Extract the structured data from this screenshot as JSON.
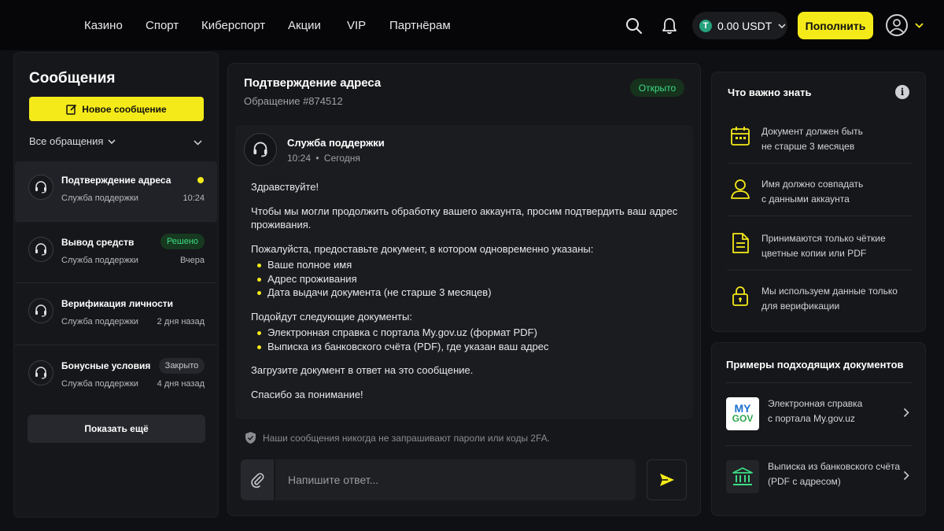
{
  "topbar": {
    "nav": [
      "Казино",
      "Спорт",
      "Киберспорт",
      "Акции",
      "VIP",
      "Партнёрам"
    ],
    "icons": {
      "search": "search-icon",
      "bell": "bell-icon",
      "user": "user-icon",
      "chevron": "chevron-down-icon"
    },
    "balance": {
      "currency_icon": "T",
      "text": "0.00 USDT"
    },
    "deposit_label": "Пополнить"
  },
  "sidebar": {
    "title": "Сообщения",
    "new_message_label": "Новое сообщение",
    "filter_label": "Все обращения",
    "conversations": [
      {
        "title": "Подтверждение адреса",
        "subtitle": "Служба поддержки",
        "time": "10:24",
        "badge": ""
      },
      {
        "title": "Вывод средств",
        "subtitle": "Служба поддержки",
        "time": "Вчера",
        "badge": "Решено"
      },
      {
        "title": "Верификация личности",
        "subtitle": "Служба поддержки",
        "time": "2 дня назад",
        "badge": ""
      },
      {
        "title": "Бонусные условия",
        "subtitle": "Служба поддержки",
        "time": "4 дня назад",
        "badge": "Закрыто"
      }
    ],
    "show_more_label": "Показать ещё"
  },
  "chat": {
    "title": "Подтверждение адреса",
    "ticket": "Обращение #874512",
    "status": "Открыто",
    "sender": "Служба поддержки",
    "sent_time": "10:24",
    "sent_day": "Сегодня",
    "greeting": "Здравствуйте!",
    "paragraph1": "Чтобы мы могли продолжить обработку вашего аккаунта, просим подтвердить ваш адрес проживания.",
    "paragraph2": "Пожалуйста, предоставьте документ, в котором одновременно указаны:",
    "list1": [
      "Ваше полное имя",
      "Адрес проживания",
      "Дата выдачи документа (не старше 3 месяцев)"
    ],
    "paragraph3": "Подойдут следующие документы:",
    "list2": [
      "Электронная справка с портала My.gov.uz (формат PDF)",
      "Выписка из банковского счёта (PDF), где указан ваш адрес"
    ],
    "paragraph4": "Загрузите документ в ответ на это сообщение.",
    "closing": "Спасибо за понимание!",
    "security_note": "Наши сообщения никогда не запрашивают пароли или коды 2FA.",
    "reply_placeholder": "Напишите ответ..."
  },
  "info": {
    "title": "Что важно знать",
    "tips": [
      {
        "icon": "calendar-icon",
        "line1": "Документ должен быть",
        "line2": "не старше 3 месяцев"
      },
      {
        "icon": "user-icon",
        "line1": "Имя должно совпадать",
        "line2": "с данными аккаунта"
      },
      {
        "icon": "document-icon",
        "line1": "Принимаются только чёткие",
        "line2": "цветные копии или PDF"
      },
      {
        "icon": "lock-icon",
        "line1": "Мы используем данные только",
        "line2": "для верификации"
      }
    ]
  },
  "examples": {
    "title": "Примеры подходящих документов",
    "items": [
      {
        "logo_top": "MY",
        "logo_bottom": "GOV",
        "line1": "Электронная справка",
        "line2": "с портала My.gov.uz"
      },
      {
        "icon": "bank-icon",
        "line1": "Выписка из банковского счёта",
        "line2": "(PDF с адресом)"
      }
    ]
  },
  "colors": {
    "accent": "#f5ea19",
    "success": "#3ddc84",
    "background": "#0f1013",
    "panel": "#16171b"
  }
}
